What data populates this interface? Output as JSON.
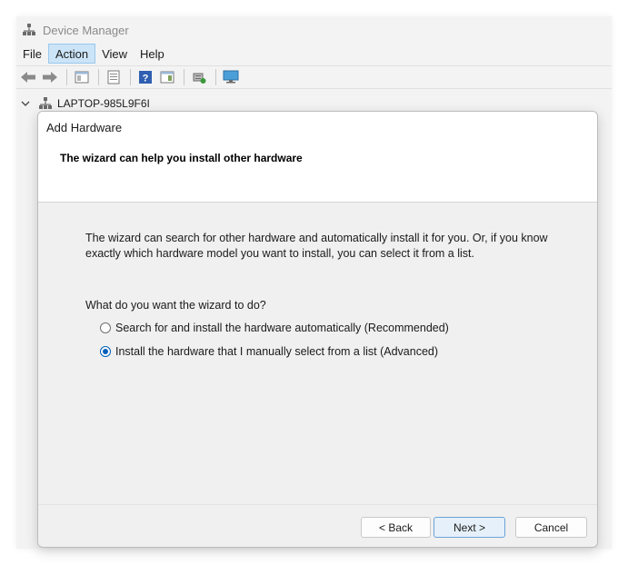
{
  "window": {
    "title": "Device Manager"
  },
  "menu": {
    "items": [
      {
        "label": "File",
        "active": false
      },
      {
        "label": "Action",
        "active": true
      },
      {
        "label": "View",
        "active": false
      },
      {
        "label": "Help",
        "active": false
      }
    ]
  },
  "toolbar": {
    "buttons": [
      "back-arrow-icon",
      "forward-arrow-icon",
      "console-tree-icon",
      "properties-icon",
      "help-icon",
      "action-pane-icon",
      "scan-hardware-icon",
      "monitor-icon"
    ]
  },
  "tree": {
    "root_label": "LAPTOP-985L9F6I"
  },
  "dialog": {
    "title": "Add Hardware",
    "heading": "The wizard can help you install other hardware",
    "description": "The wizard can search for other hardware and automatically install it for you. Or, if you know exactly which hardware model you want to install, you can select it from a list.",
    "question": "What do you want the wizard to do?",
    "options": [
      {
        "label": "Search for and install the hardware automatically (Recommended)",
        "checked": false
      },
      {
        "label": "Install the hardware that I manually select from a list (Advanced)",
        "checked": true
      }
    ],
    "buttons": {
      "back": "< Back",
      "next": "Next >",
      "cancel": "Cancel"
    }
  },
  "colors": {
    "accent": "#005fb8",
    "menu_active_bg": "#cce4f7",
    "dialog_bg": "#f0f0f0"
  }
}
